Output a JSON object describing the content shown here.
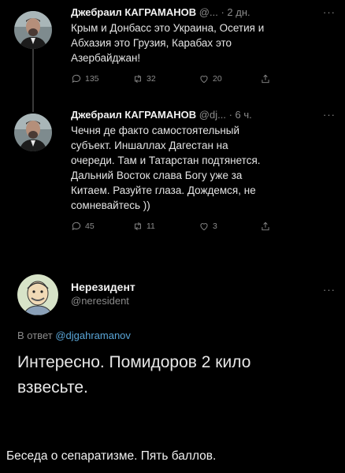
{
  "tweets": [
    {
      "author": "Джебраил КАГРАМАНОВ",
      "handle": "@...",
      "time": "· 2 дн.",
      "more": "···",
      "text_lines": [
        "Крым и Донбасс это Украина, Осетия и",
        "Абхазия это Грузия, Карабах это",
        "Азербайджан!"
      ],
      "replies": "135",
      "retweets": "32",
      "likes": "20"
    },
    {
      "author": "Джебраил КАГРАМАНОВ",
      "handle": "@dj...",
      "time": "· 6 ч.",
      "more": "···",
      "text_lines": [
        "Чечня де факто самостоятельный",
        "субъект. Иншаллах Дагестан на",
        "очереди. Там и Татарстан подтянется.",
        "Дальний Восток слава Богу уже за",
        "Китаем. Разуйте глаза. Дождемся, не",
        "сомневайтесь ))"
      ],
      "replies": "45",
      "retweets": "11",
      "likes": "3"
    }
  ],
  "reply": {
    "author": "Нерезидент",
    "handle": "@neresident",
    "more": "···",
    "reply_to_prefix": "В ответ",
    "reply_to_handle": "@djgahramanov",
    "text_lines": [
      "Интересно. Помидоров 2 кило",
      "взвесьте."
    ]
  },
  "caption": "Беседа о сепаратизме. Пять баллов.",
  "icons": {
    "reply": "comment-icon",
    "retweet": "retweet-icon",
    "like": "heart-icon",
    "share": "share-icon"
  },
  "colors": {
    "background": "#000000",
    "muted": "#8b8b8b",
    "link": "#5aa6d8"
  }
}
